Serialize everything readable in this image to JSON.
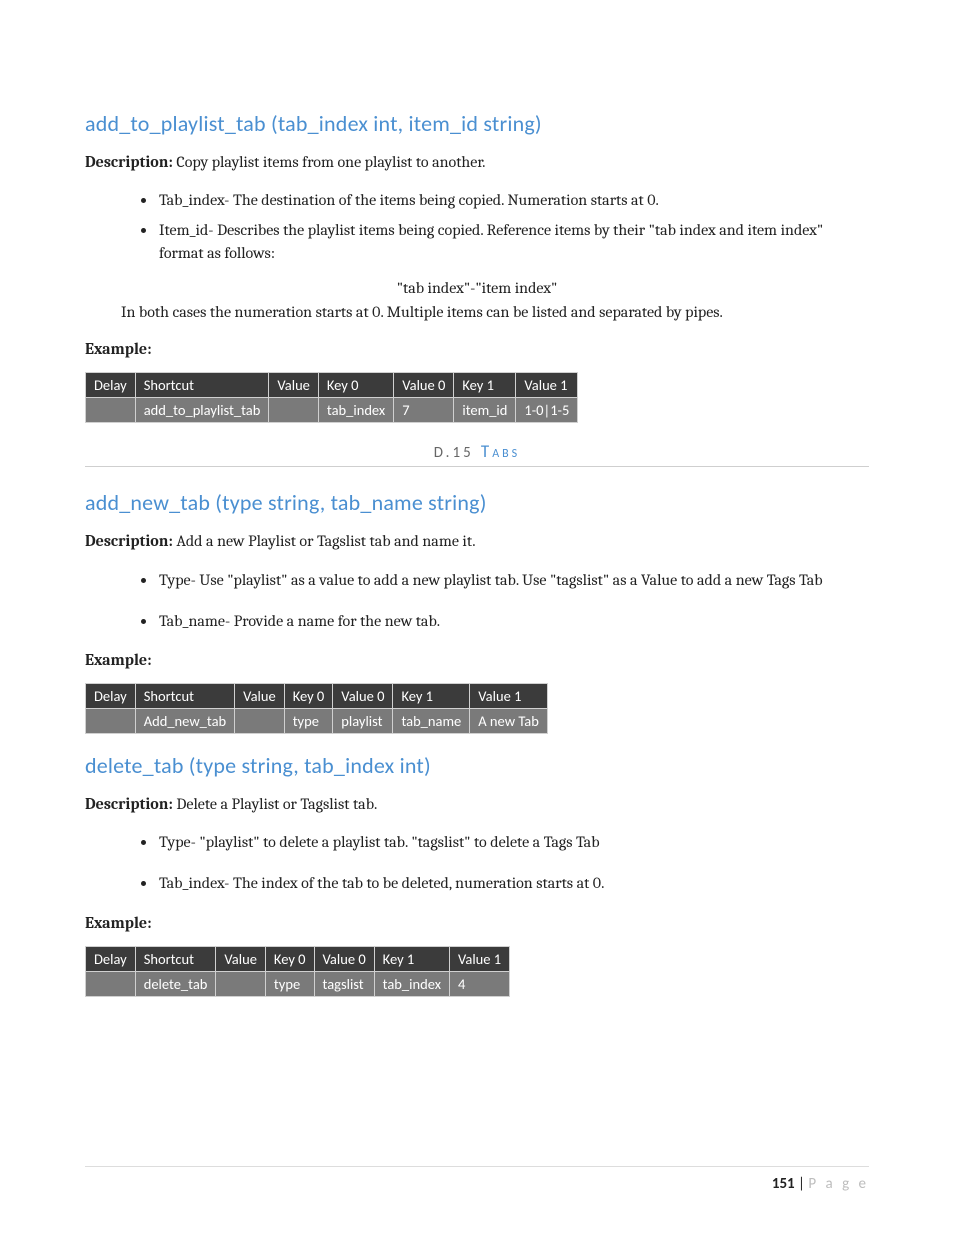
{
  "section1": {
    "heading": "add_to_playlist_tab (tab_index int, item_id string)",
    "desc_label": "Description:",
    "desc_text": " Copy playlist items from one playlist to another.",
    "bullets": [
      "Tab_index- The destination of the items being copied. Numeration starts at 0.",
      "Item_id- Describes the playlist items being copied. Reference items by their \"tab index and item index\" format as follows:"
    ],
    "center": "\"tab index\"-\"item index\"",
    "after_center": "In both cases the numeration starts at 0.  Multiple items can be listed and separated by pipes.",
    "example_label": "Example:",
    "table": {
      "headers": [
        "Delay",
        "Shortcut",
        "Value",
        "Key 0",
        "Value 0",
        "Key 1",
        "Value 1"
      ],
      "row": [
        "",
        "add_to_playlist_tab",
        "",
        "tab_index",
        "7",
        "item_id",
        "1-0|1-5"
      ]
    }
  },
  "section_divider": {
    "num": "D.15",
    "label": "Tabs"
  },
  "section2": {
    "heading": "add_new_tab (type string, tab_name string)",
    "desc_label": "Description:",
    "desc_text": " Add a new Playlist or Tagslist tab and name it.",
    "bullets": [
      "Type- Use \"playlist\" as a value to add a new playlist tab. Use \"tagslist\" as a Value to add a new Tags Tab",
      "Tab_name- Provide a name for the new tab."
    ],
    "example_label": "Example:",
    "table": {
      "headers": [
        "Delay",
        "Shortcut",
        "Value",
        "Key 0",
        "Value 0",
        "Key 1",
        "Value 1"
      ],
      "row": [
        "",
        "Add_new_tab",
        "",
        "type",
        "playlist",
        "tab_name",
        "A new Tab"
      ]
    }
  },
  "section3": {
    "heading": "delete_tab (type string, tab_index int)",
    "desc_label": "Description:",
    "desc_text": " Delete a Playlist or Tagslist tab.",
    "bullets": [
      "Type- \"playlist\" to delete a playlist tab. \"tagslist\" to delete a Tags Tab",
      "Tab_index- The index of the tab to be deleted, numeration starts at 0."
    ],
    "example_label": "Example:",
    "table": {
      "headers": [
        "Delay",
        "Shortcut",
        "Value",
        "Key 0",
        "Value 0",
        "Key 1",
        "Value 1"
      ],
      "row": [
        "",
        "delete_tab",
        "",
        "type",
        "tagslist",
        "tab_index",
        "4"
      ]
    }
  },
  "footer": {
    "page_num": "151",
    "sep": " | ",
    "page_word": "P a g e"
  }
}
